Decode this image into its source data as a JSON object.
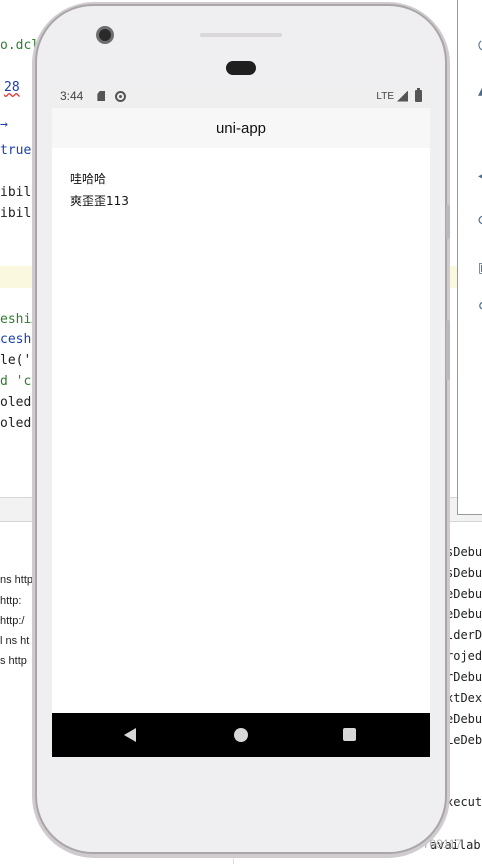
{
  "ide": {
    "code_lines": [
      {
        "text": "o.dcl",
        "cls": "green"
      },
      {
        "text": "28",
        "cls": "under"
      },
      {
        "text": "→",
        "cls": "blue"
      },
      {
        "text": "true",
        "cls": "blue"
      },
      {
        "text": "ibili",
        "cls": "dark"
      },
      {
        "text": "ibili",
        "cls": "dark"
      },
      {
        "text": "eshiAp",
        "cls": "green"
      },
      {
        "text": " cesh",
        "cls": "blue"
      },
      {
        "text": "le('c",
        "cls": "dark"
      },
      {
        "text": "d 'ce",
        "cls": "green"
      },
      {
        "text": "oled ",
        "cls": "dark"
      },
      {
        "text": "oled ",
        "cls": "dark"
      }
    ],
    "log_lines": [
      "ns http",
      " http:",
      "http:/",
      "l ns ht",
      "s http"
    ],
    "build_lines": [
      "sDebu",
      "sDebu",
      "eDebu",
      "eDebu",
      "lderD",
      "rojed",
      "rDebu",
      "xtDex",
      "eDebu",
      "LeDeb",
      "xecut",
      "availab"
    ],
    "watermark": "CSDN @qq_36709117"
  },
  "phone": {
    "status": {
      "time": "3:44",
      "network": "LTE"
    },
    "title": "uni-app",
    "content": {
      "line1": "哇哈哈",
      "line2": "爽歪歪113"
    },
    "nav_icons": [
      "back-icon",
      "home-icon",
      "recent-apps-icon"
    ]
  }
}
